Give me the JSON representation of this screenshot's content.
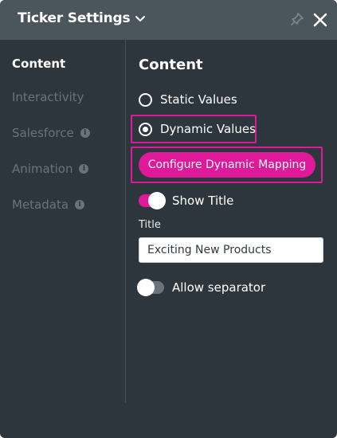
{
  "header": {
    "title": "Ticker Settings"
  },
  "sidebar": {
    "items": [
      {
        "label": "Content",
        "active": true,
        "info": false
      },
      {
        "label": "Interactivity",
        "active": false,
        "info": false
      },
      {
        "label": "Salesforce",
        "active": false,
        "info": true
      },
      {
        "label": "Animation",
        "active": false,
        "info": true
      },
      {
        "label": "Metadata",
        "active": false,
        "info": true
      }
    ]
  },
  "main": {
    "title": "Content",
    "radio_static": "Static Values",
    "radio_dynamic": "Dynamic Values",
    "radio_selected": "Dynamic Values",
    "configure_button": "Configure Dynamic Mapping",
    "show_title_label": "Show Title",
    "show_title_on": true,
    "title_field_label": "Title",
    "title_field_value": "Exciting New Products",
    "separator_label": "Allow separator",
    "separator_on": false
  },
  "colors": {
    "accent": "#e0189a",
    "header_bg": "#4a555c",
    "panel_bg": "#2d363d",
    "muted_text": "#697379"
  },
  "icons": {
    "dropdown": "chevron-down-icon",
    "pin": "pin-icon",
    "close": "close-icon",
    "info": "info-icon"
  }
}
